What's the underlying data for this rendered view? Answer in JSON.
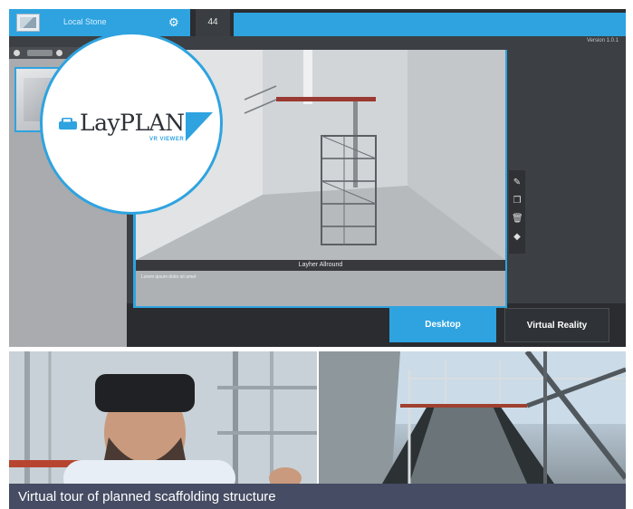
{
  "app": {
    "tab_label": "Local Stone",
    "small_tab_label": "44",
    "version_label": "Version 1.0.1",
    "scene_caption": "Layher Allround",
    "note_text": "Lorem ipsum dolor sit amet",
    "buttons": {
      "desktop": "Desktop",
      "vr": "Virtual Reality"
    },
    "icons": [
      "gear-icon",
      "edit-icon",
      "copy-icon",
      "trash-icon",
      "tag-icon"
    ]
  },
  "logo": {
    "brand": "LayPLAN",
    "sub": "VR VIEWER"
  },
  "caption": "Virtual tour of planned scaffolding structure",
  "colors": {
    "accent": "#2ea3e0",
    "caption_bg": "#454c63",
    "app_bg": "#3c3f43"
  }
}
